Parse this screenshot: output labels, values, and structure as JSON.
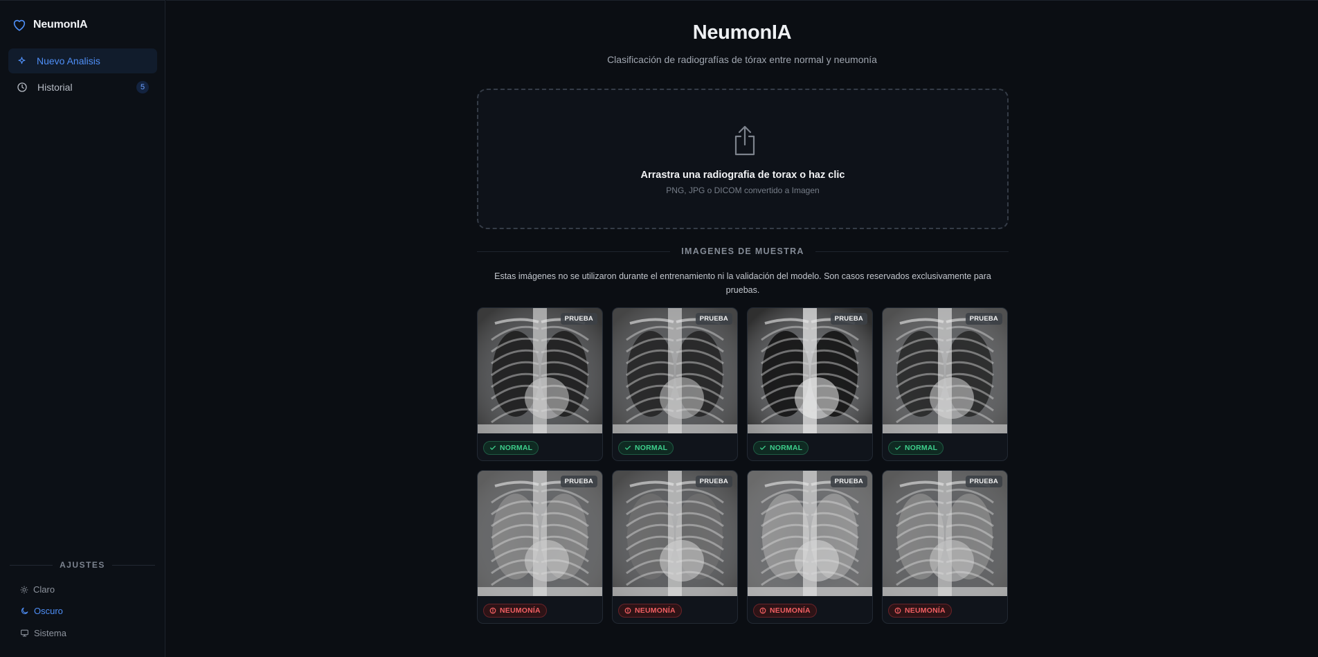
{
  "app": {
    "brand": "NeumonIA",
    "brand_color": "#4f8ff7"
  },
  "sidebar": {
    "nav": [
      {
        "label": "Nuevo Analisis",
        "icon": "sparkle-icon",
        "active": true
      },
      {
        "label": "Historial",
        "icon": "clock-icon",
        "count": "5"
      }
    ],
    "settings_title": "AJUSTES",
    "themes": [
      {
        "label": "Claro",
        "icon": "sun-icon"
      },
      {
        "label": "Oscuro",
        "icon": "moon-icon",
        "active": true
      },
      {
        "label": "Sistema",
        "icon": "monitor-icon"
      }
    ]
  },
  "main": {
    "title": "NeumonIA",
    "subtitle": "Clasificación de radiografías de tórax entre normal y neumonía",
    "dropzone": {
      "title": "Arrastra una radiografia de torax o haz clic",
      "hint": "PNG, JPG o DICOM convertido a Imagen"
    },
    "samples": {
      "heading": "IMAGENES DE MUESTRA",
      "description": "Estas imágenes no se utilizaron durante el entrenamiento ni la validación del modelo. Son casos reservados exclusivamente para pruebas.",
      "tag": "PRUEBA",
      "items": [
        {
          "result": "NORMAL",
          "kind": "normal"
        },
        {
          "result": "NORMAL",
          "kind": "normal"
        },
        {
          "result": "NORMAL",
          "kind": "normal"
        },
        {
          "result": "NORMAL",
          "kind": "normal"
        },
        {
          "result": "NEUMONÍA",
          "kind": "pneu"
        },
        {
          "result": "NEUMONÍA",
          "kind": "pneu"
        },
        {
          "result": "NEUMONÍA",
          "kind": "pneu"
        },
        {
          "result": "NEUMONÍA",
          "kind": "pneu"
        }
      ]
    }
  },
  "colors": {
    "normal": "#3ed08d",
    "pneumonia": "#f25f62"
  }
}
